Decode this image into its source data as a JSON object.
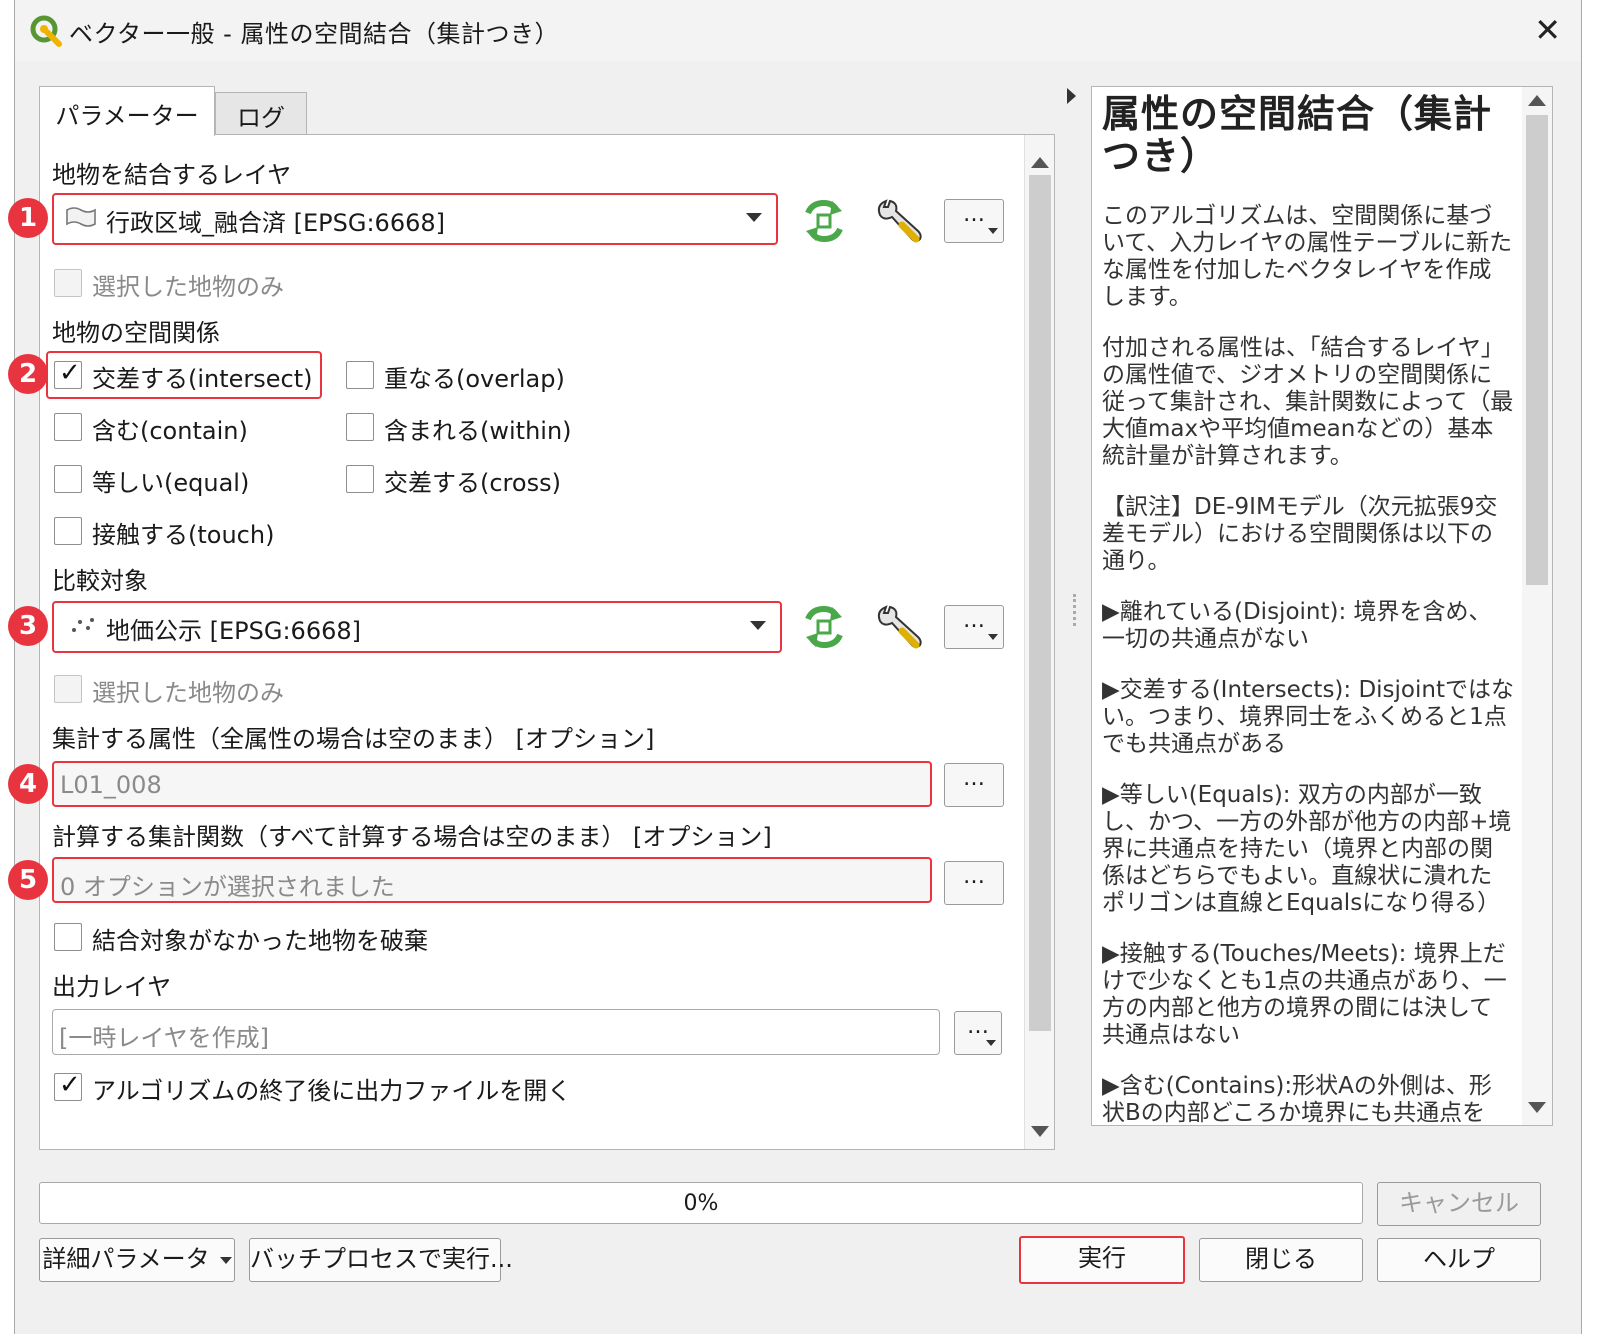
{
  "window": {
    "title": "ベクター一般 - 属性の空間結合（集計つき）"
  },
  "tabs": [
    {
      "label": "パラメーター"
    },
    {
      "label": "ログ"
    }
  ],
  "params": {
    "join_layer_label": "地物を結合するレイヤ",
    "join_layer_value": "行政区域_融合済 [EPSG:6668]",
    "selected_only_label": "選択した地物のみ",
    "predicate_label": "地物の空間関係",
    "predicates": [
      {
        "label": "交差する(intersect)",
        "checked": true
      },
      {
        "label": "重なる(overlap)",
        "checked": false
      },
      {
        "label": "含む(contain)",
        "checked": false
      },
      {
        "label": "含まれる(within)",
        "checked": false
      },
      {
        "label": "等しい(equal)",
        "checked": false
      },
      {
        "label": "交差する(cross)",
        "checked": false
      },
      {
        "label": "接触する(touch)",
        "checked": false
      }
    ],
    "compare_label": "比較対象",
    "compare_value": "地価公示 [EPSG:6668]",
    "selected_only_label_2": "選択した地物のみ",
    "fields_label": "集計する属性（全属性の場合は空のまま） [オプション]",
    "fields_value": "L01_008",
    "summaries_label": "計算する集計関数（すべて計算する場合は空のまま） [オプション]",
    "summaries_value": "0 オプションが選択されました",
    "discard_label": "結合対象がなかった地物を破棄",
    "output_label": "出力レイヤ",
    "output_placeholder": "[一時レイヤを作成]",
    "open_after_label": "アルゴリズムの終了後に出力ファイルを開く",
    "dots": "…"
  },
  "markers": [
    "1",
    "2",
    "3",
    "4",
    "5"
  ],
  "help": {
    "title": "属性の空間結合（集計つき）",
    "paragraphs": [
      "このアルゴリズムは、空間関係に基づいて、入力レイヤの属性テーブルに新たな属性を付加したベクタレイヤを作成します。",
      "付加される属性は、「結合するレイヤ」の属性値で、ジオメトリの空間関係に従って集計され、集計関数によって（最大値maxや平均値meanなどの）基本統計量が計算されます。",
      "【訳注】DE-9IMモデル（次元拡張9交差モデル）における空間関係は以下の通り。",
      "▶離れている(Disjoint): 境界を含め、一切の共通点がない",
      "▶交差する(Intersects): Disjointではない。つまり、境界同士をふくめると1点でも共通点がある",
      "▶等しい(Equals): 双方の内部が一致し、かつ、一方の外部が他方の内部+境界に共通点を持たい（境界と内部の関係はどちらでもよい。直線状に潰れたポリゴンは直線とEqualsになり得る）",
      "▶接触する(Touches/Meets): 境界上だけで少なくとも1点の共通点があり、一方の内部と他方の境界の間には決して共通点はない",
      "▶含む(Contains):形状Aの外側は、形状Bの内部どころか境界にも共通点を"
    ]
  },
  "progress": {
    "percent": 0,
    "text": "0%"
  },
  "buttons": {
    "cancel": "キャンセル",
    "advanced": "詳細パラメータ",
    "batch": "バッチプロセスで実行...",
    "run": "実行",
    "close": "閉じる",
    "help": "ヘルプ"
  },
  "colors": {
    "annotation_red": "#e8343f",
    "qgis_green": "#589632",
    "refresh_green": "#4aa84a"
  }
}
